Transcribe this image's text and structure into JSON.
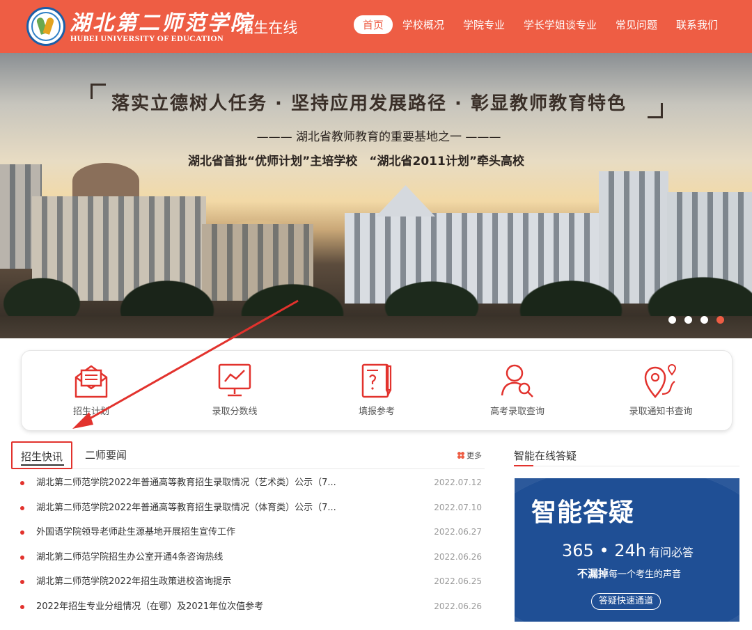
{
  "colors": {
    "brand": "#ee5d44",
    "accent_red": "#e2322d",
    "nav_text": "#ffffff",
    "qa_bg": "#1f4f95"
  },
  "header": {
    "logo_cn": "湖北第二师范学院",
    "logo_en": "HUBEI UNIVERSITY OF EDUCATION",
    "logo_sub": "· 招生在线",
    "nav": [
      {
        "label": "首页",
        "active": true
      },
      {
        "label": "学校概况"
      },
      {
        "label": "学院专业"
      },
      {
        "label": "学长学姐谈专业"
      },
      {
        "label": "常见问题"
      },
      {
        "label": "联系我们"
      }
    ]
  },
  "banner": {
    "slogan1": "落实立德树人任务 · 坚持应用发展路径 · 彰显教师教育特色",
    "slogan2": "——— 湖北省教师教育的重要基地之一 ———",
    "slogan3": "湖北省首批“优师计划”主培学校　“湖北省2011计划”牵头高校",
    "slide_count": 4,
    "active_slide": 4
  },
  "quick_links": [
    {
      "label": "招生计划",
      "icon": "envelope-doc-icon"
    },
    {
      "label": "录取分数线",
      "icon": "chart-monitor-icon"
    },
    {
      "label": "填报参考",
      "icon": "guide-book-icon"
    },
    {
      "label": "高考录取查询",
      "icon": "user-search-icon"
    },
    {
      "label": "录取通知书查询",
      "icon": "map-pin-icon"
    }
  ],
  "news": {
    "tabs": [
      "招生快讯",
      "二师要闻"
    ],
    "more_label": "更多",
    "items": [
      {
        "title": "湖北第二师范学院2022年普通高等教育招生录取情况（艺术类）公示（7...",
        "date": "2022.07.12"
      },
      {
        "title": "湖北第二师范学院2022年普通高等教育招生录取情况（体育类）公示（7...",
        "date": "2022.07.10"
      },
      {
        "title": "外国语学院领导老师赴生源基地开展招生宣传工作",
        "date": "2022.06.27"
      },
      {
        "title": "湖北第二师范学院招生办公室开通4条咨询热线",
        "date": "2022.06.26"
      },
      {
        "title": "湖北第二师范学院2022年招生政策进校咨询提示",
        "date": "2022.06.25"
      },
      {
        "title": "2022年招生专业分组情况（在鄂）及2021年位次值参考",
        "date": "2022.06.26"
      }
    ]
  },
  "side": {
    "title": "智能在线答疑",
    "card_big": "智能答疑",
    "card_main": "365 • 24h",
    "card_main_small": "有问必答",
    "card_sub_bold": "不漏掉",
    "card_sub_rest": "每一个考生的声音",
    "card_button": "答疑快速通道"
  }
}
